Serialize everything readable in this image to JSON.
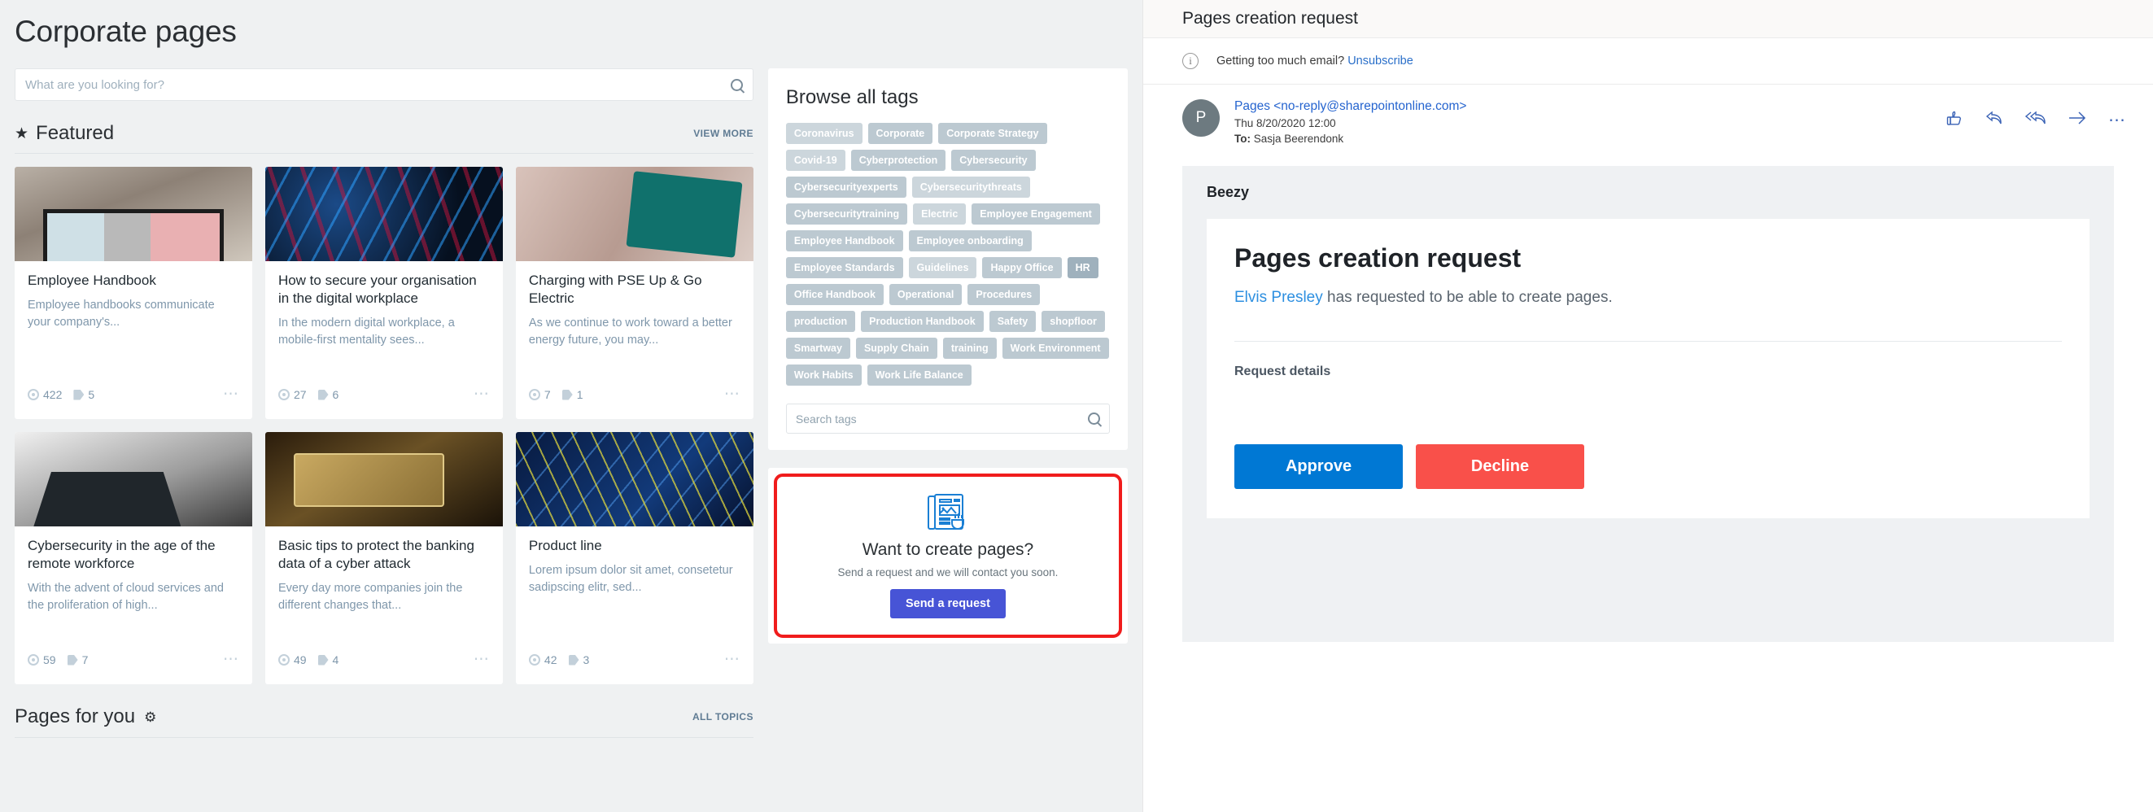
{
  "left": {
    "page_title": "Corporate pages",
    "search": {
      "placeholder": "What are you looking for?",
      "value": "",
      "icon": "search-icon"
    },
    "featured": {
      "star_icon": "star-icon",
      "title": "Featured",
      "view_more": "VIEW MORE"
    },
    "cards": [
      {
        "title": "Employee Handbook",
        "desc": "Employee handbooks communicate your company's...",
        "views": "422",
        "tags": "5",
        "more_icon": "ellipsis-icon",
        "art": "img-a"
      },
      {
        "title": "How to secure your organisation in the digital workplace",
        "desc": "In the modern digital workplace, a mobile-first mentality sees...",
        "views": "27",
        "tags": "6",
        "more_icon": "ellipsis-icon",
        "art": "img-b"
      },
      {
        "title": "Charging with PSE Up & Go Electric",
        "desc": "As we continue to work toward a better energy future, you may...",
        "views": "7",
        "tags": "1",
        "more_icon": "ellipsis-icon",
        "art": "img-c"
      },
      {
        "title": "Cybersecurity in the age of the remote workforce",
        "desc": "With the advent of cloud services and the proliferation of high...",
        "views": "59",
        "tags": "7",
        "more_icon": "ellipsis-icon",
        "art": "img-d"
      },
      {
        "title": "Basic tips to protect the banking data of a cyber attack",
        "desc": "Every day more companies join the different changes that...",
        "views": "49",
        "tags": "4",
        "more_icon": "ellipsis-icon",
        "art": "img-e"
      },
      {
        "title": "Product line",
        "desc": "Lorem ipsum dolor sit amet, consetetur sadipscing elitr, sed...",
        "views": "42",
        "tags": "3",
        "more_icon": "ellipsis-icon",
        "art": "img-f"
      }
    ],
    "pages_for_you": {
      "title": "Pages for you",
      "gear_icon": "gear-icon",
      "all_topics": "ALL TOPICS"
    },
    "tags_panel": {
      "title": "Browse all tags",
      "tags": [
        {
          "label": "Coronavirus",
          "shade": "light"
        },
        {
          "label": "Corporate",
          "shade": "normal"
        },
        {
          "label": "Corporate Strategy",
          "shade": "normal"
        },
        {
          "label": "Covid-19",
          "shade": "light"
        },
        {
          "label": "Cyberprotection",
          "shade": "normal"
        },
        {
          "label": "Cybersecurity",
          "shade": "normal"
        },
        {
          "label": "Cybersecurityexperts",
          "shade": "normal"
        },
        {
          "label": "Cybersecuritythreats",
          "shade": "light"
        },
        {
          "label": "Cybersecuritytraining",
          "shade": "normal"
        },
        {
          "label": "Electric",
          "shade": "light"
        },
        {
          "label": "Employee Engagement",
          "shade": "normal"
        },
        {
          "label": "Employee Handbook",
          "shade": "normal"
        },
        {
          "label": "Employee onboarding",
          "shade": "normal"
        },
        {
          "label": "Employee Standards",
          "shade": "normal"
        },
        {
          "label": "Guidelines",
          "shade": "light"
        },
        {
          "label": "Happy Office",
          "shade": "normal"
        },
        {
          "label": "HR",
          "shade": "dark"
        },
        {
          "label": "Office Handbook",
          "shade": "normal"
        },
        {
          "label": "Operational",
          "shade": "normal"
        },
        {
          "label": "Procedures",
          "shade": "normal"
        },
        {
          "label": "production",
          "shade": "normal"
        },
        {
          "label": "Production Handbook",
          "shade": "normal"
        },
        {
          "label": "Safety",
          "shade": "normal"
        },
        {
          "label": "shopfloor",
          "shade": "normal"
        },
        {
          "label": "Smartway",
          "shade": "normal"
        },
        {
          "label": "Supply Chain",
          "shade": "normal"
        },
        {
          "label": "training",
          "shade": "normal"
        },
        {
          "label": "Work Environment",
          "shade": "normal"
        },
        {
          "label": "Work Habits",
          "shade": "normal"
        },
        {
          "label": "Work Life Balance",
          "shade": "normal"
        }
      ],
      "search": {
        "placeholder": "Search tags",
        "value": "",
        "icon": "search-icon"
      }
    },
    "promo": {
      "icon": "news-pages-icon",
      "title": "Want to create pages?",
      "subtitle": "Send a request and we will contact you soon.",
      "button": "Send a request",
      "highlight_color": "#f01c1c",
      "button_color": "#4754d6"
    }
  },
  "right": {
    "subject": "Pages creation request",
    "notice": {
      "icon": "info-icon",
      "text": "Getting too much email?",
      "link": "Unsubscribe"
    },
    "sender": {
      "avatar_initial": "P",
      "name": "Pages <no-reply@sharepointonline.com>",
      "date": "Thu 8/20/2020 12:00",
      "to_label": "To:",
      "to_value": "Sasja Beerendonk"
    },
    "actions": [
      {
        "icon": "thumbs-up-icon",
        "glyph": "👍"
      },
      {
        "icon": "reply-icon",
        "glyph": "↩"
      },
      {
        "icon": "reply-all-icon",
        "glyph": "⇇"
      },
      {
        "icon": "forward-icon",
        "glyph": "→"
      },
      {
        "icon": "more-options-icon",
        "glyph": "⋯"
      }
    ],
    "body": {
      "brand": "Beezy",
      "heading": "Pages creation request",
      "requester": "Elvis Presley",
      "sentence_rest": " has requested to be able to create pages.",
      "request_details_label": "Request details",
      "approve_button": "Approve",
      "decline_button": "Decline",
      "approve_color": "#0078d4",
      "decline_color": "#f9504a"
    }
  }
}
